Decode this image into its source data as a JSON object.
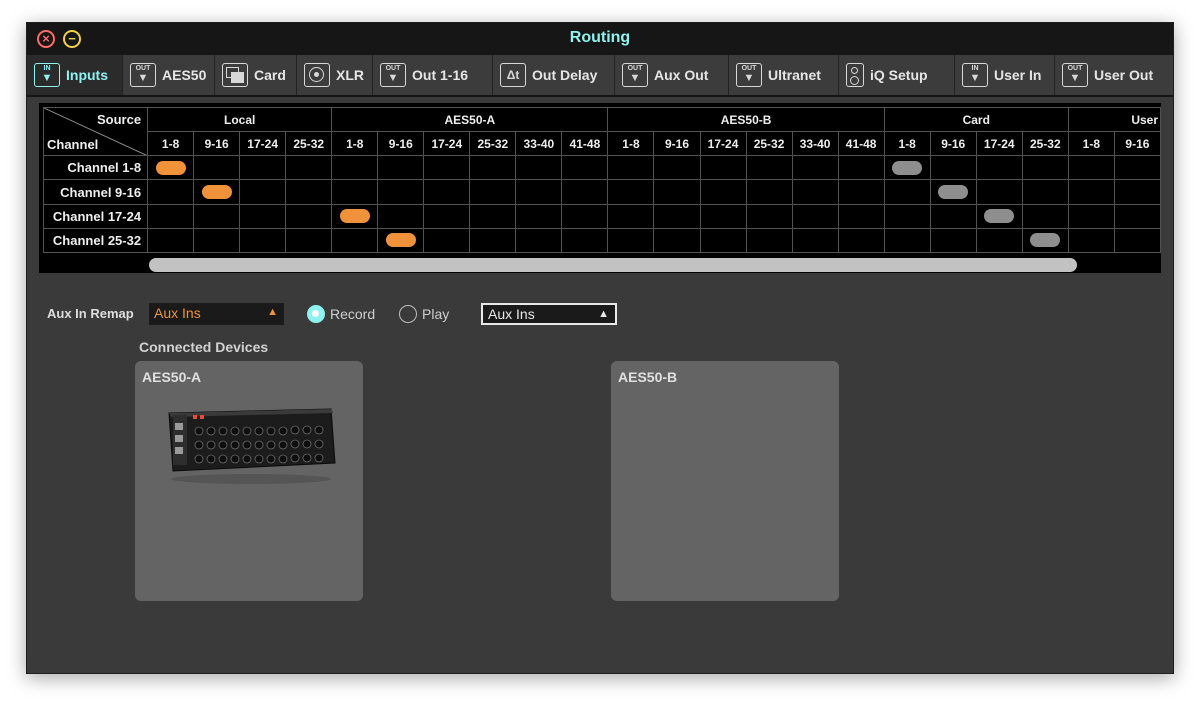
{
  "window": {
    "title": "Routing",
    "close_glyph": "×",
    "minimize_glyph": "−"
  },
  "tabs": [
    {
      "label": "Inputs",
      "icon": "input-port-icon",
      "icon_text": "IN",
      "active": true
    },
    {
      "label": "AES50",
      "icon": "output-port-icon",
      "icon_text": "OUT",
      "active": false
    },
    {
      "label": "Card",
      "icon": "card-icon",
      "icon_text": "",
      "active": false
    },
    {
      "label": "XLR",
      "icon": "xlr-icon",
      "icon_text": "",
      "active": false
    },
    {
      "label": "Out 1-16",
      "icon": "output-port-icon",
      "icon_text": "OUT",
      "active": false
    },
    {
      "label": "Out Delay",
      "icon": "delay-icon",
      "icon_text": "Δt",
      "active": false
    },
    {
      "label": "Aux Out",
      "icon": "output-port-icon",
      "icon_text": "OUT",
      "active": false
    },
    {
      "label": "Ultranet",
      "icon": "output-port-icon",
      "icon_text": "OUT",
      "active": false
    },
    {
      "label": "iQ Setup",
      "icon": "speaker-icon",
      "icon_text": "",
      "active": false
    },
    {
      "label": "User In",
      "icon": "input-port-icon",
      "icon_text": "IN",
      "active": false
    },
    {
      "label": "User Out",
      "icon": "output-port-icon",
      "icon_text": "OUT",
      "active": false
    }
  ],
  "matrix": {
    "source_label": "Source",
    "channel_label": "Channel",
    "groups": [
      {
        "name": "Local",
        "cols": [
          "1-8",
          "9-16",
          "17-24",
          "25-32"
        ]
      },
      {
        "name": "AES50-A",
        "cols": [
          "1-8",
          "9-16",
          "17-24",
          "25-32",
          "33-40",
          "41-48"
        ]
      },
      {
        "name": "AES50-B",
        "cols": [
          "1-8",
          "9-16",
          "17-24",
          "25-32",
          "33-40",
          "41-48"
        ]
      },
      {
        "name": "Card",
        "cols": [
          "1-8",
          "9-16",
          "17-24",
          "25-32"
        ]
      },
      {
        "name": "User",
        "cols": [
          "1-8",
          "9-16"
        ]
      }
    ],
    "rows": [
      "Channel 1-8",
      "Channel 9-16",
      "Channel 17-24",
      "Channel 25-32"
    ],
    "routes": [
      {
        "row": 0,
        "col": 0,
        "color": "orange"
      },
      {
        "row": 1,
        "col": 1,
        "color": "orange"
      },
      {
        "row": 2,
        "col": 4,
        "color": "orange"
      },
      {
        "row": 3,
        "col": 5,
        "color": "orange"
      },
      {
        "row": 0,
        "col": 16,
        "color": "gray"
      },
      {
        "row": 1,
        "col": 17,
        "color": "gray"
      },
      {
        "row": 2,
        "col": 18,
        "color": "gray"
      },
      {
        "row": 3,
        "col": 19,
        "color": "gray"
      }
    ],
    "colors": {
      "orange": "#f0923a",
      "gray": "#8e8e8e"
    }
  },
  "aux_remap": {
    "label": "Aux In Remap",
    "select_value": "Aux Ins",
    "record_label": "Record",
    "play_label": "Play",
    "selected": "Record",
    "target_value": "Aux Ins"
  },
  "connected_devices": {
    "heading": "Connected Devices",
    "devices": [
      {
        "name": "AES50-A",
        "has_device": true
      },
      {
        "name": "AES50-B",
        "has_device": false
      }
    ]
  },
  "colors": {
    "accent": "#8ef2ee",
    "orange": "#f0923a",
    "window_bg": "#3a3a3a"
  }
}
